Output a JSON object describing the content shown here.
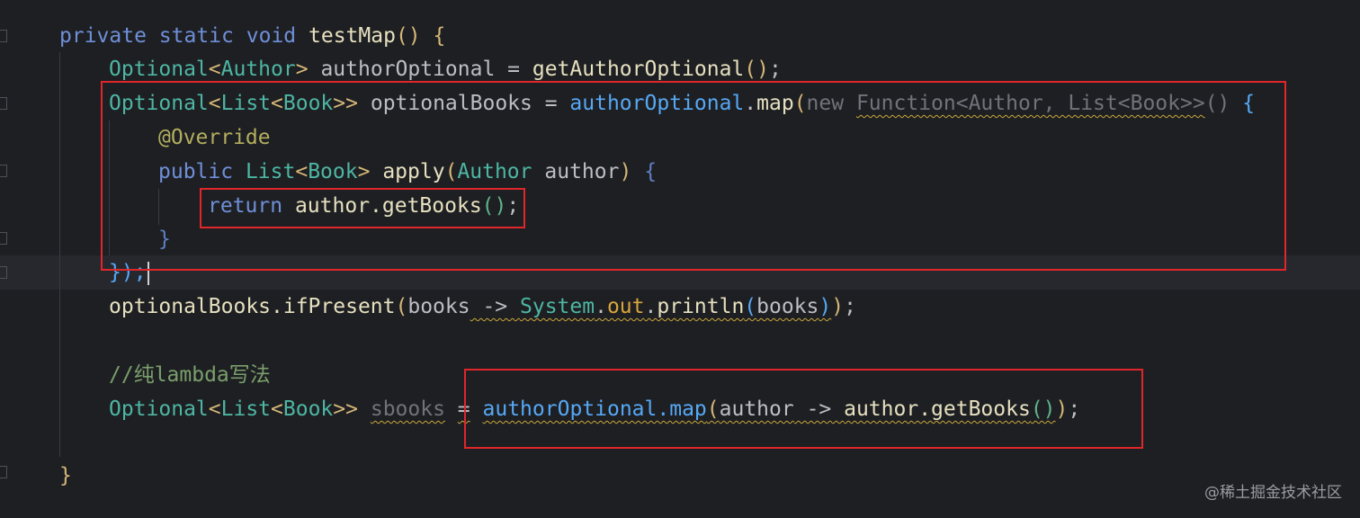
{
  "code": {
    "l1": {
      "kw1": "private",
      "kw2": "static",
      "kw3": "void",
      "name": "testMap",
      "open": "()",
      "brace": "{"
    },
    "l2": {
      "type": "Optional",
      "lt": "<",
      "gen": "Author",
      "gt": ">",
      "var": "authorOptional",
      "eq": " = ",
      "call": "getAuthorOptional",
      "parens": "()",
      "semi": ";"
    },
    "l3": {
      "type": "Optional",
      "lt1": "<",
      "list": "List",
      "lt2": "<",
      "book": "Book",
      "gt": ">>",
      "var": "optionalBooks",
      "eq": " = ",
      "recv": "authorOptional",
      "dot": ".",
      "map": "map",
      "po": "(",
      "new": "new",
      "anon": "Function<Author, List<Book>>",
      "args": "()",
      "brace": "{"
    },
    "l4": {
      "ann": "@Override"
    },
    "l5": {
      "kw": "public",
      "type": "List",
      "lt": "<",
      "gen": "Book",
      "gt": ">",
      "name": "apply",
      "po": "(",
      "ptype": "Author",
      "pname": "author",
      "pc": ")",
      "brace": "{"
    },
    "l6": {
      "kw": "return",
      "expr": "author.getBooks",
      "parens": "()",
      "semi": ";"
    },
    "l7": {
      "brace": "}"
    },
    "l8": {
      "close": "});"
    },
    "l9": {
      "recv": "optionalBooks.ifPresent",
      "po": "(",
      "param": "books",
      "arrow": " -> ",
      "sys": "System",
      "dot1": ".",
      "out": "out",
      "dot2": ".",
      "println": "println",
      "pi": "(",
      "arg": "books",
      "pc": ")",
      "pc2": ")",
      "semi": ";"
    },
    "l11": {
      "comment": "//纯lambda写法"
    },
    "l12": {
      "type": "Optional",
      "lt1": "<",
      "list": "List",
      "lt2": "<",
      "book": "Book",
      "gt": ">>",
      "var": "sbooks",
      "eq": "=",
      "recv": "authorOptional.map",
      "po": "(",
      "param": "author",
      "arrow": " -> ",
      "call": "author.getBooks",
      "args": "()",
      "pc": ")",
      "semi": ";"
    },
    "l14": {
      "brace": "}"
    }
  },
  "watermark": "@稀土掘金技术社区",
  "colors": {
    "background": "#1e1f22",
    "highlight_box": "#e0262a",
    "keyword": "#6f8fd8",
    "type": "#4db6a4",
    "comment": "#7a9f6c"
  }
}
